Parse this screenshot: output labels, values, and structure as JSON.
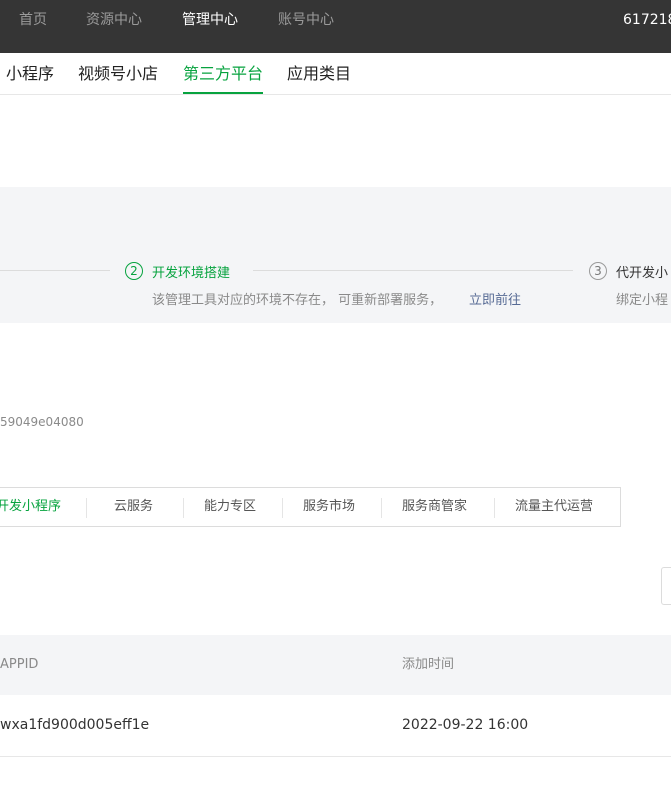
{
  "topnav": {
    "items": [
      "首页",
      "资源中心",
      "管理中心",
      "账号中心"
    ],
    "account": "617218"
  },
  "subnav": {
    "tabs": [
      "小程序",
      "视频号小店",
      "第三方平台",
      "应用类目"
    ]
  },
  "steps": {
    "step2": {
      "number": "2",
      "title": "开发环境搭建",
      "desc": "该管理工具对应的环境不存在， 可重新部署服务，",
      "link": "立即前往"
    },
    "step3": {
      "number": "3",
      "title": "代开发小",
      "desc": "绑定小程"
    }
  },
  "appid_partial": "59049e04080",
  "tooltabs": [
    "开发小程序",
    "云服务",
    "能力专区",
    "服务市场",
    "服务商管家",
    "流量主代运营"
  ],
  "table": {
    "headers": [
      "APPID",
      "添加时间"
    ],
    "rows": [
      {
        "appid": "wxa1fd900d005eff1e",
        "time": "2022-09-22 16:00"
      }
    ]
  },
  "colors": {
    "accent": "#07a33f",
    "topnav_bg": "#353535",
    "link": "#576b95"
  }
}
